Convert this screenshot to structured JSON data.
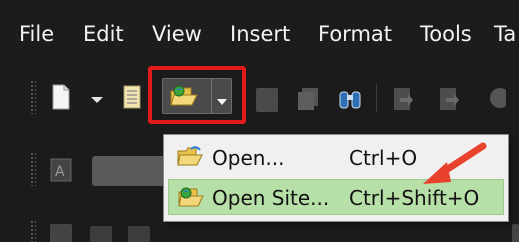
{
  "menubar": {
    "items": [
      "File",
      "Edit",
      "View",
      "Insert",
      "Format",
      "Tools",
      "Ta"
    ]
  },
  "dropdown": {
    "items": [
      {
        "label": "Open...",
        "shortcut": "Ctrl+O"
      },
      {
        "label": "Open Site...",
        "shortcut": "Ctrl+Shift+O"
      }
    ]
  },
  "icons": {
    "new": "new-file-icon",
    "open": "open-folder-icon",
    "open_site": "open-site-icon",
    "save": "save-icon",
    "find": "binoculars-icon",
    "arrow": "red-arrow-annotation"
  },
  "colors": {
    "background": "#1c1c1c",
    "menu_text": "#f3f3f3",
    "highlight": "#e21a1a",
    "dropdown_bg": "#f0f0f0",
    "active_item": "#b7e0a8"
  }
}
